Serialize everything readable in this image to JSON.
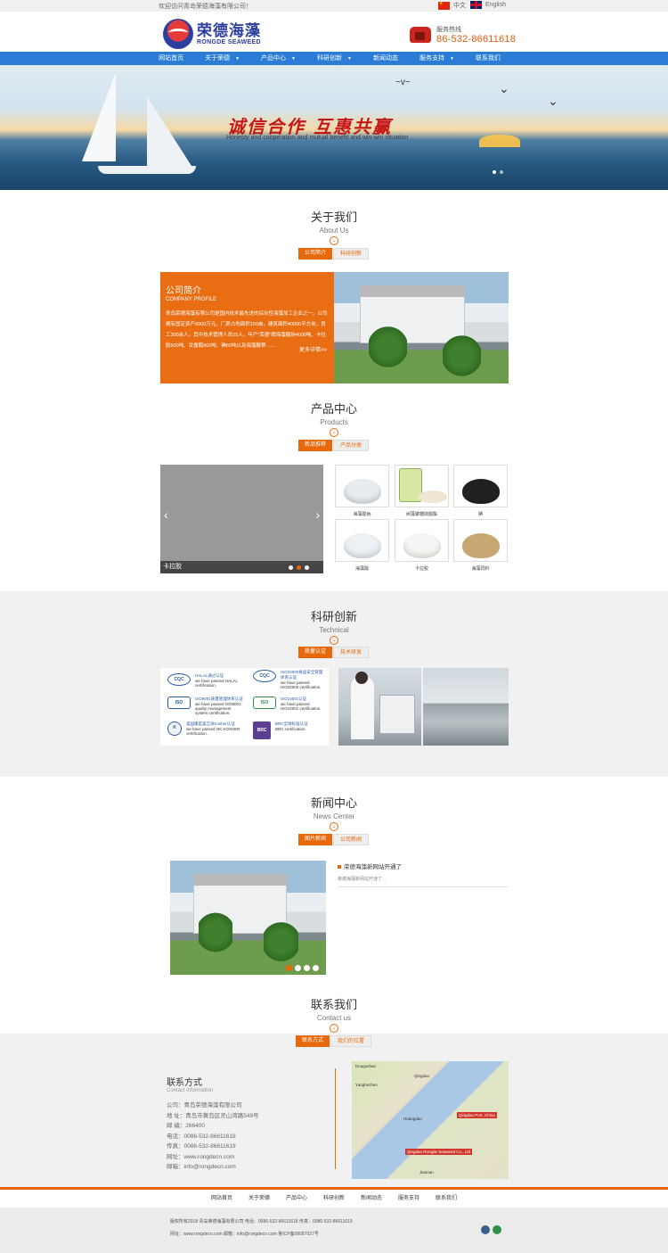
{
  "topbar": {
    "welcome": "欢迎访问青岛荣德海藻有限公司！",
    "lang_cn": "中文",
    "lang_en": "English"
  },
  "header": {
    "logo_cn": "荣德海藻",
    "logo_en": "RONGDE SEAWEED",
    "logo_mark_text": "RONGDE",
    "hotline_label": "服务热线",
    "hotline_number": "86-532-86611618"
  },
  "nav": {
    "items": [
      "网站首页",
      "关于荣德",
      "产品中心",
      "科研创新",
      "新闻动态",
      "服务支持",
      "联系我们"
    ]
  },
  "banner": {
    "slogan_cn": "诚信合作 互惠共赢",
    "slogan_en": "Honesty and cooperation and mutual benefit and win-win situation"
  },
  "about": {
    "title_cn": "关于我们",
    "title_en": "About Us",
    "tabs": [
      "公司简介",
      "科研创新"
    ],
    "box_title": "公司简介",
    "box_subtitle": "COMPANY PROFILE",
    "box_text": "青岛荣德海藻有限公司是国内技术最先进的综合性海藻加工企业之一。公司拥有固定资产6000万元，厂房占地面积150亩，建筑面积40000平方米，员工300余人，其中技术管理人员25人。年产\"荣德\"牌海藻酸钠4000吨、卡拉胶500吨、甘露醇800吨、碘60吨以及海藻酸钾……",
    "more": "更多详情>>"
  },
  "products": {
    "title_cn": "产品中心",
    "title_en": "Products",
    "tabs": [
      "新品推荐",
      "产品分类"
    ],
    "slider_caption": "卡拉胶",
    "items": [
      "海藻酸钠",
      "树藻聚糖硫酸酯",
      "碘",
      "海藻酸",
      "卡拉胶",
      "海藻饲料"
    ]
  },
  "tech": {
    "title_cn": "科研创新",
    "title_en": "Technical",
    "tabs": [
      "质量认证",
      "技术研发"
    ],
    "certs": [
      {
        "logo": "CQC",
        "t1": "HALAL通过认证",
        "t2": "we have passed HALAL certification."
      },
      {
        "logo": "CQC",
        "t1": "ISO22000食品安全管理体系认证",
        "t2": "we have passed ISO22000 certification."
      },
      {
        "logo": "ISO",
        "t1": "ISO9001质量管理体系认证",
        "t2": "we have passed ISO9001 quality management system certification."
      },
      {
        "logo": "ISO",
        "t1": "ISO14001认证",
        "t2": "we have passed ISO14001 certification."
      },
      {
        "logo": "K",
        "t1": "美国康是美洁净Kosher认证",
        "t2": "we have passed OK KOSHER certification."
      },
      {
        "logo": "BRC",
        "t1": "BRC全球标准认证",
        "t2": "BRC certification."
      }
    ]
  },
  "news": {
    "title_cn": "新闻中心",
    "title_en": "News Center",
    "tabs": [
      "图片新闻",
      "公司新闻"
    ],
    "item_title": "荣德海藻新网站开通了",
    "item_summary": "荣德海藻新网站开通了..."
  },
  "contact": {
    "title_cn": "联系我们",
    "title_en": "Contact us",
    "tabs": [
      "联系方式",
      "我们的位置"
    ],
    "info_title": "联系方式",
    "info_subtitle": "Contact information",
    "rows": [
      "公司：青岛荣德海藻有限公司",
      "地 址：青岛市黄岛区灵山湾路549号",
      "邮 编：266400",
      "电话：0086-532-86611618",
      "传真：0086-532-86611619",
      "网址：www.rongdecn.com",
      "邮箱：info@rongdecn.com"
    ],
    "map_labels": [
      "Dougushan",
      "Yanghezhen",
      "Qingdao",
      "Huangdao",
      "Qingdao Port, China",
      "Qingdao Rongde Seaweed Co., Ltd",
      "Jiaonan"
    ]
  },
  "footer": {
    "nav": [
      "网站首页",
      "关于荣德",
      "产品中心",
      "科研创新",
      "新闻动态",
      "服务支持",
      "联系我们"
    ],
    "line1": "版权所有2018 青岛荣德海藻有限公司 电话：0086-532-86611618 传真：0086-532-86611619",
    "line2": "网址：www.rongdecn.com 邮箱：info@rongdecn.com 鲁ICP备09087027号"
  },
  "colors": {
    "accent": "#e8690c",
    "nav": "#2a7cd6",
    "brand": "#2c3f9e"
  }
}
